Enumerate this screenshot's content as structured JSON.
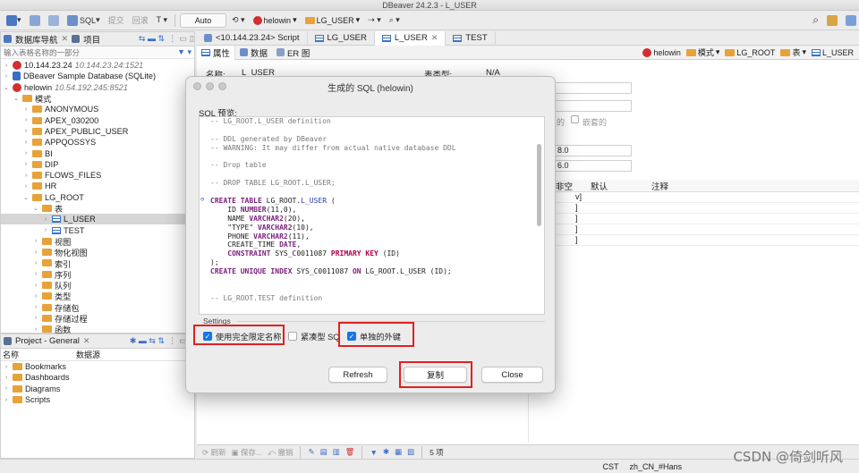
{
  "window": {
    "title": "DBeaver 24.2.3 - L_USER"
  },
  "toolbar": {
    "sql": "SQL",
    "commit": "提交",
    "rollback": "回滚",
    "auto": "Auto",
    "connection": "helowin",
    "schema": "LG_USER"
  },
  "navigator": {
    "tab1": "数据库导航",
    "tab2": "项目",
    "filter_placeholder": "输入表格名称的一部分",
    "rows": [
      {
        "label": "10.144.23.24",
        "sub": "10.144.23.24:1521",
        "depth": 0,
        "arrow": "›",
        "icon": "oracle"
      },
      {
        "label": "DBeaver Sample Database (SQLite)",
        "sub": "",
        "depth": 0,
        "arrow": "›",
        "icon": "sqlite"
      },
      {
        "label": "helowin",
        "sub": "10.54.192.245:8521",
        "depth": 0,
        "arrow": "⌄",
        "icon": "oracle"
      },
      {
        "label": "模式",
        "sub": "",
        "depth": 1,
        "arrow": "⌄",
        "icon": "folder"
      },
      {
        "label": "ANONYMOUS",
        "sub": "",
        "depth": 2,
        "arrow": "›",
        "icon": "folder"
      },
      {
        "label": "APEX_030200",
        "sub": "",
        "depth": 2,
        "arrow": "›",
        "icon": "folder"
      },
      {
        "label": "APEX_PUBLIC_USER",
        "sub": "",
        "depth": 2,
        "arrow": "›",
        "icon": "folder"
      },
      {
        "label": "APPQOSSYS",
        "sub": "",
        "depth": 2,
        "arrow": "›",
        "icon": "folder"
      },
      {
        "label": "BI",
        "sub": "",
        "depth": 2,
        "arrow": "›",
        "icon": "folder"
      },
      {
        "label": "DIP",
        "sub": "",
        "depth": 2,
        "arrow": "›",
        "icon": "folder"
      },
      {
        "label": "FLOWS_FILES",
        "sub": "",
        "depth": 2,
        "arrow": "›",
        "icon": "folder"
      },
      {
        "label": "HR",
        "sub": "",
        "depth": 2,
        "arrow": "›",
        "icon": "folder"
      },
      {
        "label": "LG_ROOT",
        "sub": "",
        "depth": 2,
        "arrow": "⌄",
        "icon": "folder"
      },
      {
        "label": "表",
        "sub": "",
        "depth": 3,
        "arrow": "⌄",
        "icon": "folder"
      },
      {
        "label": "L_USER",
        "sub": "",
        "depth": 4,
        "arrow": "›",
        "icon": "table",
        "selected": true
      },
      {
        "label": "TEST",
        "sub": "",
        "depth": 4,
        "arrow": "›",
        "icon": "table"
      },
      {
        "label": "视图",
        "sub": "",
        "depth": 3,
        "arrow": "›",
        "icon": "folder"
      },
      {
        "label": "物化视图",
        "sub": "",
        "depth": 3,
        "arrow": "›",
        "icon": "folder"
      },
      {
        "label": "索引",
        "sub": "",
        "depth": 3,
        "arrow": "›",
        "icon": "folder"
      },
      {
        "label": "序列",
        "sub": "",
        "depth": 3,
        "arrow": "›",
        "icon": "folder"
      },
      {
        "label": "队列",
        "sub": "",
        "depth": 3,
        "arrow": "›",
        "icon": "folder"
      },
      {
        "label": "类型",
        "sub": "",
        "depth": 3,
        "arrow": "›",
        "icon": "folder"
      },
      {
        "label": "存储包",
        "sub": "",
        "depth": 3,
        "arrow": "›",
        "icon": "folder"
      },
      {
        "label": "存储过程",
        "sub": "",
        "depth": 3,
        "arrow": "›",
        "icon": "folder"
      },
      {
        "label": "函数",
        "sub": "",
        "depth": 3,
        "arrow": "›",
        "icon": "folder"
      }
    ]
  },
  "project": {
    "title": "Project - General",
    "col_name": "名称",
    "col_source": "数据源",
    "items": [
      "Bookmarks",
      "Dashboards",
      "Diagrams",
      "Scripts"
    ]
  },
  "editor": {
    "tabs": [
      {
        "label": "<10.144.23.24> Script",
        "active": false
      },
      {
        "label": "LG_USER",
        "active": false
      },
      {
        "label": "L_USER",
        "active": true
      },
      {
        "label": "TEST",
        "active": false
      }
    ],
    "subtabs": [
      "属性",
      "数据",
      "ER 图"
    ],
    "right_conn": "helowin",
    "right_schema": "模式",
    "right_root": "LG_ROOT",
    "right_table_kw": "表",
    "right_table": "L_USER",
    "name_label": "名称:",
    "name_value": "L_USER",
    "type_label": "表类型:",
    "type_value": "N/A",
    "frag_de": "的",
    "frag_nested": "嵌套的",
    "frag_val1": "8.0",
    "frag_val2": "6.0",
    "col_nullable": "非空",
    "col_default": "默认",
    "col_comment": "注释",
    "frag_rows": [
      "v]",
      "]",
      "]",
      "]",
      "]"
    ],
    "bottom_refresh": "刷新",
    "bottom_save": "保存...",
    "bottom_cancel": "撤销",
    "count": "5 项"
  },
  "dialog": {
    "title": "生成的 SQL (helowin)",
    "preview_label": "SQL 预览:",
    "settings_label": "Settings",
    "opt_fullname": "使用完全限定名称",
    "opt_compact": "紧凑型 SQL",
    "opt_fk": "单独的外键",
    "btn_refresh": "Refresh",
    "btn_copy": "复制",
    "btn_close": "Close",
    "sql_lines": [
      [
        [
          "c",
          "-- LG_ROOT.L_USER definition"
        ]
      ],
      [],
      [
        [
          "c",
          "-- DDL generated by DBeaver"
        ]
      ],
      [
        [
          "c",
          "-- WARNING: It may differ from actual native database DDL"
        ]
      ],
      [],
      [
        [
          "c",
          "-- Drop table"
        ]
      ],
      [],
      [
        [
          "c",
          "-- DROP TABLE LG_ROOT.L_USER;"
        ]
      ],
      [],
      [
        [
          "k",
          "CREATE TABLE "
        ],
        [
          "p",
          "LG_ROOT."
        ],
        [
          "n",
          "L_USER"
        ],
        [
          "p",
          " ("
        ]
      ],
      [
        [
          "p",
          "    ID "
        ],
        [
          "k",
          "NUMBER"
        ],
        [
          "p",
          "(11,0),"
        ]
      ],
      [
        [
          "p",
          "    NAME "
        ],
        [
          "k",
          "VARCHAR2"
        ],
        [
          "p",
          "(20),"
        ]
      ],
      [
        [
          "p",
          "    \"TYPE\" "
        ],
        [
          "k",
          "VARCHAR2"
        ],
        [
          "p",
          "(10),"
        ]
      ],
      [
        [
          "p",
          "    PHONE "
        ],
        [
          "k",
          "VARCHAR2"
        ],
        [
          "p",
          "(11),"
        ]
      ],
      [
        [
          "p",
          "    CREATE_TIME "
        ],
        [
          "k",
          "DATE"
        ],
        [
          "p",
          ","
        ]
      ],
      [
        [
          "p",
          "    "
        ],
        [
          "k",
          "CONSTRAINT"
        ],
        [
          "p",
          " SYS_C0011087 "
        ],
        [
          "k2",
          "PRIMARY KEY"
        ],
        [
          "p",
          " (ID)"
        ]
      ],
      [
        [
          "p",
          ");"
        ]
      ],
      [
        [
          "k",
          "CREATE UNIQUE INDEX"
        ],
        [
          "p",
          " SYS_C0011087 "
        ],
        [
          "k",
          "ON"
        ],
        [
          "p",
          " LG_ROOT.L_USER (ID);"
        ]
      ],
      [],
      [],
      [
        [
          "c",
          "-- LG_ROOT.TEST definition"
        ]
      ]
    ]
  },
  "status": {
    "timezone": "CST",
    "locale": "zh_CN_#Hans"
  },
  "watermark": "CSDN @倚剑听风"
}
